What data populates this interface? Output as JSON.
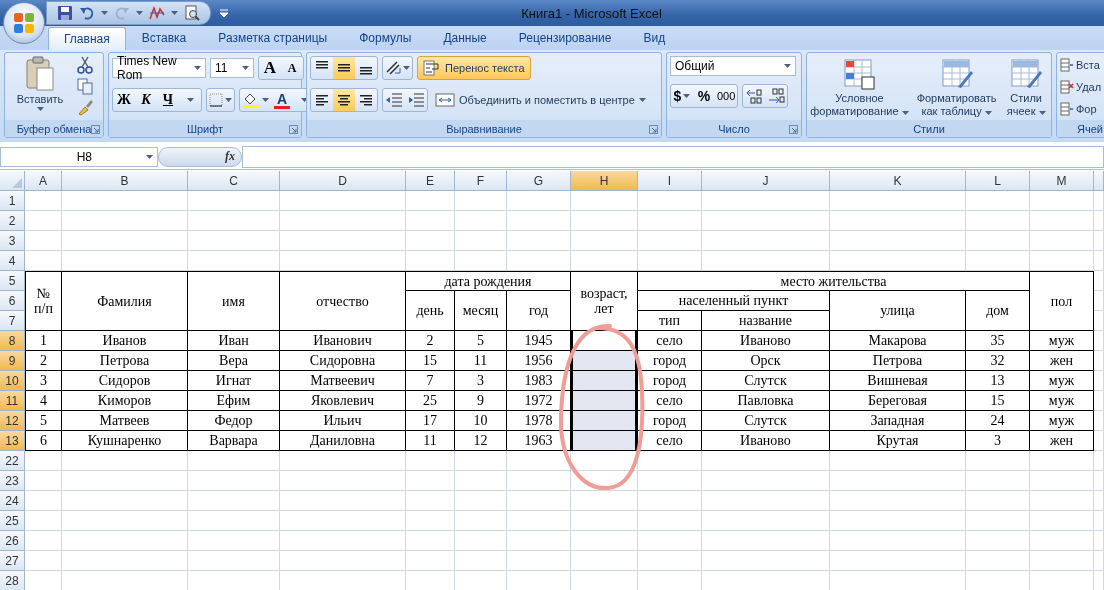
{
  "window": {
    "title": "Книга1 - Microsoft Excel"
  },
  "tabs": [
    {
      "label": "Главная",
      "selected": true
    },
    {
      "label": "Вставка",
      "selected": false
    },
    {
      "label": "Разметка страницы",
      "selected": false
    },
    {
      "label": "Формулы",
      "selected": false
    },
    {
      "label": "Данные",
      "selected": false
    },
    {
      "label": "Рецензирование",
      "selected": false
    },
    {
      "label": "Вид",
      "selected": false
    }
  ],
  "ribbon": {
    "clipboard": {
      "label": "Буфер обмена",
      "paste": "Вставить"
    },
    "font": {
      "label": "Шрифт",
      "font_name": "Times New Rom",
      "font_size": "11",
      "grow": "A",
      "shrink": "A",
      "bold": "Ж",
      "italic": "К",
      "underline": "Ч",
      "font_color": "A"
    },
    "alignment": {
      "label": "Выравнивание",
      "vertical": [
        {
          "selected": false
        },
        {
          "selected": true
        },
        {
          "selected": false
        }
      ],
      "horizontal": [
        {
          "selected": false
        },
        {
          "selected": true
        },
        {
          "selected": false
        }
      ],
      "wrap_text": {
        "label": "Перенос текста",
        "on": true
      },
      "merge": "Объединить и поместить в центре"
    },
    "number": {
      "label": "Число",
      "format": "Общий",
      "currency": "$",
      "percent": "%",
      "thousands": "000"
    },
    "styles": {
      "label": "Стили",
      "buttons": [
        "Условное форматирование",
        "Форматировать как таблицу",
        "Стили ячеек"
      ]
    },
    "cells": {
      "label": "Ячей",
      "buttons": [
        "Вста",
        "Удал",
        "Фор"
      ]
    }
  },
  "formula_bar": {
    "name_box": "H8",
    "fx": "fx"
  },
  "sheet": {
    "columns": [
      {
        "label": "A",
        "selected": false
      },
      {
        "label": "B",
        "selected": false
      },
      {
        "label": "C",
        "selected": false
      },
      {
        "label": "D",
        "selected": false
      },
      {
        "label": "E",
        "selected": false
      },
      {
        "label": "F",
        "selected": false
      },
      {
        "label": "G",
        "selected": false
      },
      {
        "label": "H",
        "selected": true
      },
      {
        "label": "I",
        "selected": false
      },
      {
        "label": "J",
        "selected": false
      },
      {
        "label": "K",
        "selected": false
      },
      {
        "label": "L",
        "selected": false
      },
      {
        "label": "M",
        "selected": false
      }
    ],
    "rows": [
      {
        "label": "1",
        "selected": false
      },
      {
        "label": "2",
        "selected": false
      },
      {
        "label": "3",
        "selected": false
      },
      {
        "label": "4",
        "selected": false
      },
      {
        "label": "5",
        "selected": false
      },
      {
        "label": "6",
        "selected": false
      },
      {
        "label": "7",
        "selected": false
      },
      {
        "label": "8",
        "selected": true
      },
      {
        "label": "9",
        "selected": true
      },
      {
        "label": "10",
        "selected": true
      },
      {
        "label": "11",
        "selected": true
      },
      {
        "label": "12",
        "selected": true
      },
      {
        "label": "13",
        "selected": true
      },
      {
        "label": "22",
        "selected": false
      },
      {
        "label": "23",
        "selected": false
      },
      {
        "label": "24",
        "selected": false
      },
      {
        "label": "25",
        "selected": false
      },
      {
        "label": "26",
        "selected": false
      },
      {
        "label": "27",
        "selected": false
      },
      {
        "label": "28",
        "selected": false
      }
    ]
  },
  "table": {
    "header": [
      {
        "text": "№ п/п"
      },
      {
        "text": "Фамилия"
      },
      {
        "text": "имя"
      },
      {
        "text": "отчество"
      },
      {
        "text": "дата рождения",
        "children": [
          {
            "text": "день"
          },
          {
            "text": "месяц"
          },
          {
            "text": "год"
          }
        ]
      },
      {
        "text": "возраст, лет",
        "kind": "input"
      },
      {
        "text": "место жительства",
        "children": [
          {
            "text": "населенный пункт",
            "children": [
              {
                "text": "тип"
              },
              {
                "text": "название"
              }
            ]
          },
          {
            "text": "улица"
          },
          {
            "text": "дом"
          }
        ]
      },
      {
        "text": "пол"
      }
    ],
    "rows": [
      {
        "cells": [
          "1",
          "Иванов",
          "Иван",
          "Иванович",
          "2",
          "5",
          "1945",
          "село",
          "Иваново",
          "Макарова",
          "35",
          "муж"
        ],
        "age_active": true
      },
      {
        "cells": [
          "2",
          "Петрова",
          "Вера",
          "Сидоровна",
          "15",
          "11",
          "1956",
          "город",
          "Орск",
          "Петрова",
          "32",
          "жен"
        ],
        "age_active": false
      },
      {
        "cells": [
          "3",
          "Сидоров",
          "Игнат",
          "Матвеевич",
          "7",
          "3",
          "1983",
          "город",
          "Слутск",
          "Вишневая",
          "13",
          "муж"
        ],
        "age_active": false
      },
      {
        "cells": [
          "4",
          "Киморов",
          "Ефим",
          "Яковлевич",
          "25",
          "9",
          "1972",
          "село",
          "Павловка",
          "Береговая",
          "15",
          "муж"
        ],
        "age_active": false
      },
      {
        "cells": [
          "5",
          "Матвеев",
          "Федор",
          "Ильич",
          "17",
          "10",
          "1978",
          "город",
          "Слутск",
          "Западная",
          "24",
          "муж"
        ],
        "age_active": false
      },
      {
        "cells": [
          "6",
          "Кушнаренко",
          "Варвара",
          "Даниловна",
          "11",
          "12",
          "1963",
          "село",
          "Иваново",
          "Крутая",
          "3",
          "жен"
        ],
        "age_active": false
      }
    ]
  }
}
